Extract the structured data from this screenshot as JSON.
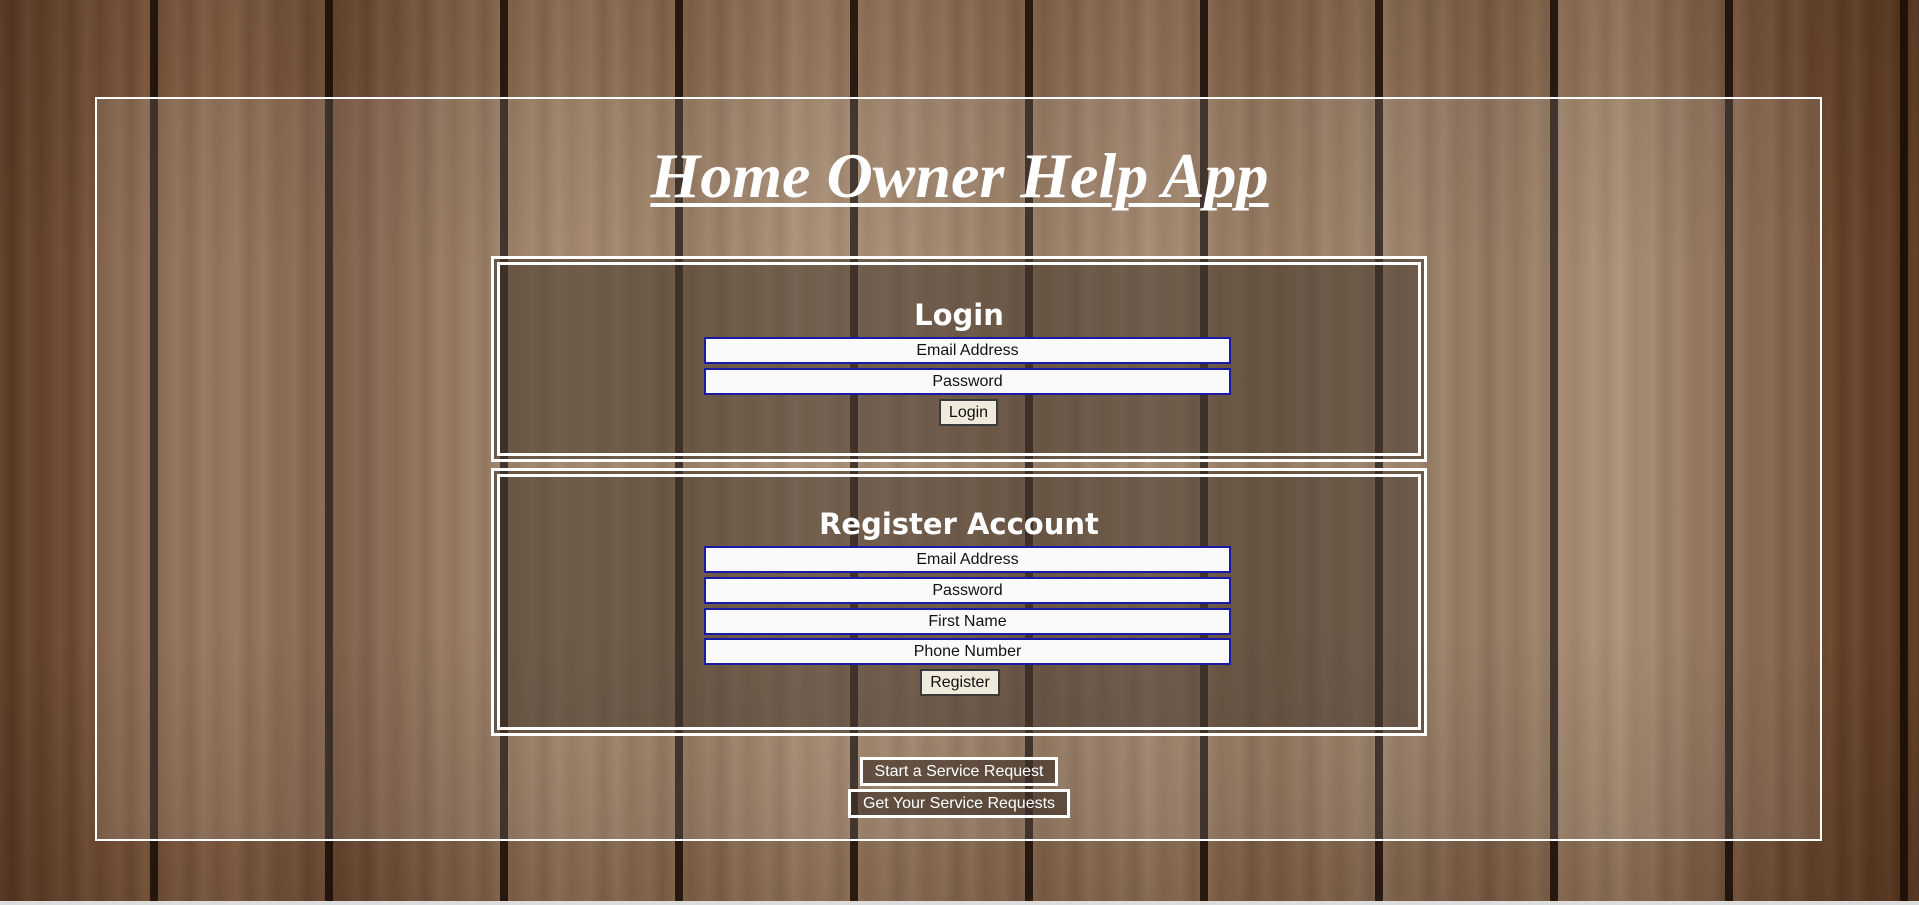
{
  "app": {
    "title": "Home Owner Help App"
  },
  "login": {
    "heading": "Login",
    "email_placeholder": "Email Address",
    "password_placeholder": "Password",
    "submit_label": "Login"
  },
  "register": {
    "heading": "Register Account",
    "email_placeholder": "Email Address",
    "password_placeholder": "Password",
    "first_name_placeholder": "First Name",
    "phone_placeholder": "Phone Number",
    "submit_label": "Register"
  },
  "actions": {
    "start_request_label": "Start a Service Request",
    "get_requests_label": "Get Your Service Requests"
  },
  "colors": {
    "field_border": "#1a1aa6",
    "frame_border": "#ffffff",
    "text": "#ffffff"
  }
}
